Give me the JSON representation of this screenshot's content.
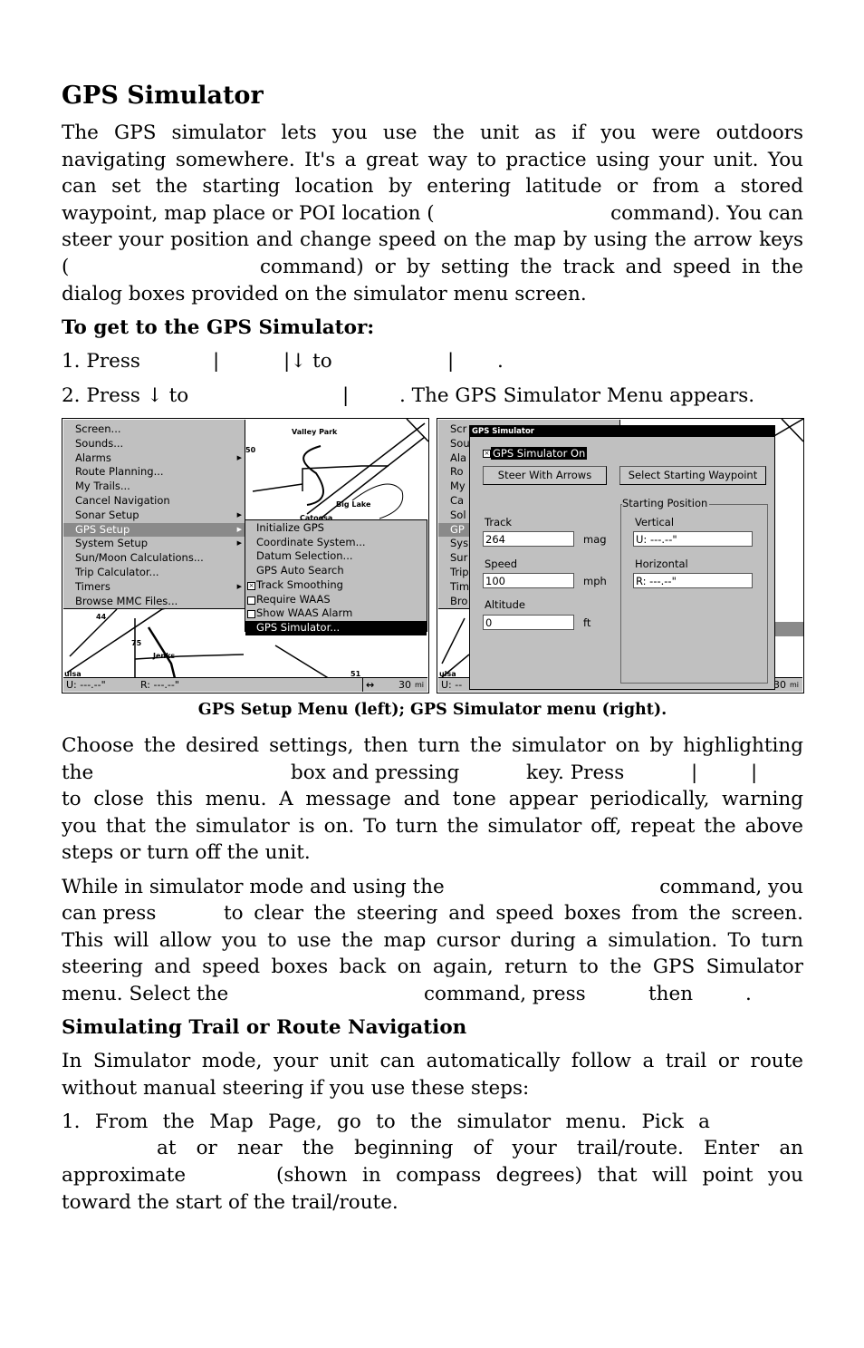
{
  "title": "GPS Simulator",
  "intro": [
    "The GPS simulator lets you use the unit as if you were outdoors",
    "navigating somewhere. It's a great way to practice using your unit. You",
    "can set the starting location by entering latitude or from a stored",
    [
      "waypoint, map place or POI location (",
      "command). You can"
    ],
    "steer your position and change speed on the map by using the arrow keys",
    [
      "(",
      "command) or by setting the track and speed in the"
    ],
    "dialog boxes provided on the simulator menu screen."
  ],
  "get_heading": "To get to the GPS Simulator:",
  "step1": {
    "a": "1. Press",
    "b": "|",
    "c": "|↓ to",
    "d": "|",
    "e": "."
  },
  "step2": {
    "a": "2. Press ↓ to",
    "b": "|",
    "c": ". The GPS Simulator Menu appears."
  },
  "left_shot": {
    "menu": [
      {
        "label": "Screen..."
      },
      {
        "label": "Sounds..."
      },
      {
        "label": "Alarms",
        "sub": true
      },
      {
        "label": "Route Planning..."
      },
      {
        "label": "My Trails..."
      },
      {
        "label": "Cancel Navigation"
      },
      {
        "label": "Sonar Setup",
        "sub": true
      },
      {
        "label": "GPS Setup",
        "sub": true,
        "selected": true
      },
      {
        "label": "System Setup",
        "sub": true
      },
      {
        "label": "Sun/Moon Calculations..."
      },
      {
        "label": "Trip Calculator..."
      },
      {
        "label": "Timers",
        "sub": true
      },
      {
        "label": "Browse MMC Files..."
      }
    ],
    "submenu": [
      {
        "label": "Initialize GPS"
      },
      {
        "label": "Coordinate System..."
      },
      {
        "label": "Datum Selection..."
      },
      {
        "label": "GPS Auto Search"
      },
      {
        "label": "Track Smoothing",
        "checkbox": true,
        "checked": true
      },
      {
        "label": "Require WAAS",
        "checkbox": true,
        "checked": false
      },
      {
        "label": "Show WAAS Alarm",
        "checkbox": true,
        "checked": false
      },
      {
        "label": "GPS Simulator...",
        "highlighted": true
      }
    ],
    "map_labels": {
      "valley_park": "Valley Park",
      "big_lake": "Big Lake",
      "catoosa": "Catoosa",
      "jenks": "Jenks",
      "tulsa": "ulsa",
      "hwy44": "44",
      "hwy75": "75",
      "hwy51": "51",
      "n50": "50"
    },
    "status": {
      "u": "U:  ---.--\"",
      "r": "R:  ---.--\"",
      "zoom_icon": "↔",
      "scale": "30",
      "unit": "mi"
    }
  },
  "right_shot": {
    "bg_menu": [
      "Scr",
      "Sou",
      "Ala",
      "Ro",
      "My",
      "Ca",
      "Sol",
      "GP",
      "Sys",
      "Sur",
      "Trip",
      "Tim",
      "Bro"
    ],
    "dialog_title": "GPS Simulator",
    "sim_on_label": "GPS Simulator On",
    "sim_on_checked": true,
    "steer_button": "Steer With Arrows",
    "waypoint_button": "Select Starting Waypoint",
    "track_label": "Track",
    "track_value": "264",
    "track_unit": "mag",
    "speed_label": "Speed",
    "speed_value": "100",
    "speed_unit": "mph",
    "altitude_label": "Altitude",
    "altitude_value": "0",
    "altitude_unit": "ft",
    "start_pos_label": "Starting Position",
    "vertical_label": "Vertical",
    "vertical_value": "U:  ---.--\"",
    "horizontal_label": "Horizontal",
    "horizontal_value": "R:  ---.--\"",
    "status_u": "U:  --",
    "tulsa": "ulsa",
    "scale": "30",
    "unit": "mi"
  },
  "caption": "GPS Setup Menu (left); GPS Simulator menu (right).",
  "para2": [
    "Choose the desired settings, then turn the simulator on by highlighting",
    [
      "the",
      "box and pressing",
      "key. Press",
      "|",
      "|"
    ],
    "to close this menu. A message and tone appear periodically, warning",
    "you that the simulator is on. To turn the simulator off, repeat the above",
    "steps or turn off the unit."
  ],
  "para3": [
    [
      "While in simulator mode and using the",
      "command, you"
    ],
    [
      "can press",
      "to clear the steering and speed boxes from the screen."
    ],
    "This will allow you to use the map cursor during a simulation. To turn",
    "steering and speed boxes back on again, return to the GPS Simulator",
    [
      "menu. Select the",
      "command, press",
      "then",
      "."
    ]
  ],
  "trail_heading": "Simulating Trail or Route Navigation",
  "para4": [
    "In Simulator mode, your unit can automatically follow a trail or route",
    "without manual steering if you use these steps:"
  ],
  "step_trail": [
    "1. From the Map Page, go to the simulator menu. Pick a",
    "at or near the beginning of your trail/route. Enter an",
    [
      "approximate",
      "(shown in compass degrees) that will point you"
    ],
    "toward the start of the trail/route."
  ]
}
